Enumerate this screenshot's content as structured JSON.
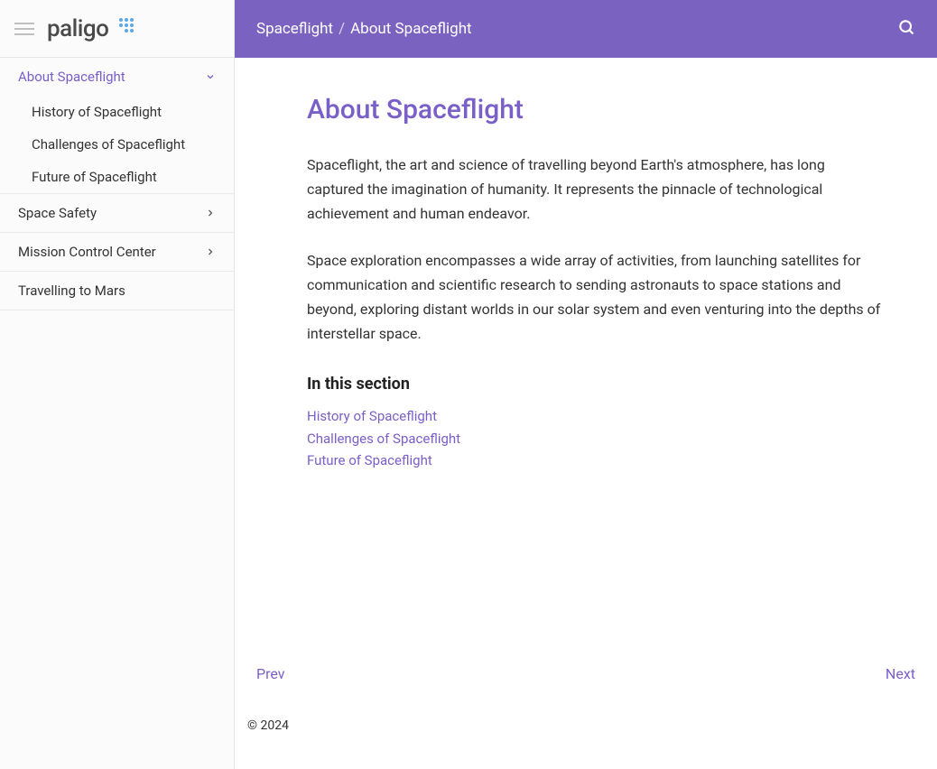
{
  "logo": {
    "text": "paligo"
  },
  "sidebar": {
    "items": [
      {
        "label": "About Spaceflight",
        "active": true,
        "expanded": true,
        "children": [
          {
            "label": "History of Spaceflight"
          },
          {
            "label": "Challenges of Spaceflight"
          },
          {
            "label": "Future of Spaceflight"
          }
        ]
      },
      {
        "label": "Space Safety",
        "expandable": true
      },
      {
        "label": "Mission Control Center",
        "expandable": true
      },
      {
        "label": "Travelling to Mars"
      }
    ]
  },
  "breadcrumb": {
    "root": "Spaceflight",
    "current": "About Spaceflight",
    "sep": "/"
  },
  "page": {
    "title": "About Spaceflight",
    "paragraphs": [
      "Spaceflight, the art and science of travelling beyond Earth's atmosphere, has long captured the imagination of humanity. It represents the pinnacle of technological achievement and human endeavor.",
      "Space exploration encompasses a wide array of activities, from launching satellites for communication and scientific research to sending astronauts to space stations and beyond, exploring distant worlds in our solar system and even venturing into the depths of interstellar space."
    ],
    "section_heading": "In this section",
    "section_links": [
      "History of Spaceflight",
      "Challenges of Spaceflight",
      "Future of Spaceflight"
    ]
  },
  "pager": {
    "prev": "Prev",
    "next": "Next"
  },
  "footer": {
    "copyright": "© 2024"
  }
}
